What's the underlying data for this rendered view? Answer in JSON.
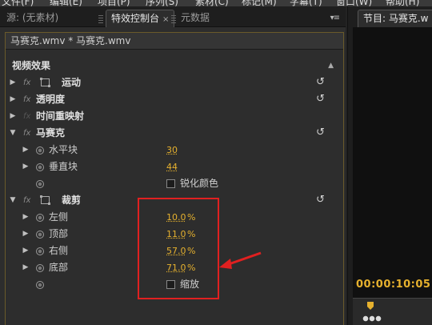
{
  "menubar": {
    "items": [
      "文件(F)",
      "编辑(E)",
      "项目(P)",
      "序列(S)",
      "素材(C)",
      "标记(M)",
      "字幕(T)",
      "窗口(W)",
      "帮助(H)"
    ]
  },
  "tabs": {
    "source": "源: (无素材)",
    "effect_controls": "特效控制台",
    "close": "×",
    "metadata": "元数据",
    "panel_menu": "▾≡"
  },
  "clip_header": "马赛克.wmv * 马赛克.wmv",
  "section_title": "视频效果",
  "effects": {
    "motion": "运动",
    "opacity": "透明度",
    "time_remap": "时间重映射",
    "mosaic": "马赛克",
    "crop": "裁剪"
  },
  "mosaic_params": {
    "h_blocks_label": "水平块",
    "h_blocks_value": "30",
    "v_blocks_label": "垂直块",
    "v_blocks_value": "44",
    "sharpen_label": "锐化颜色"
  },
  "crop_params": {
    "left_label": "左侧",
    "left_value": "10.0",
    "top_label": "顶部",
    "top_value": "11.0",
    "right_label": "右侧",
    "right_value": "57.0",
    "bottom_label": "底部",
    "bottom_value": "71.0",
    "unit": "%",
    "zoom_label": "缩放"
  },
  "program": {
    "tab": "节目: 马赛克.w",
    "timecode": "00:00:10:05"
  },
  "colors": {
    "value": "#e6b12e",
    "highlight": "#e02020"
  }
}
